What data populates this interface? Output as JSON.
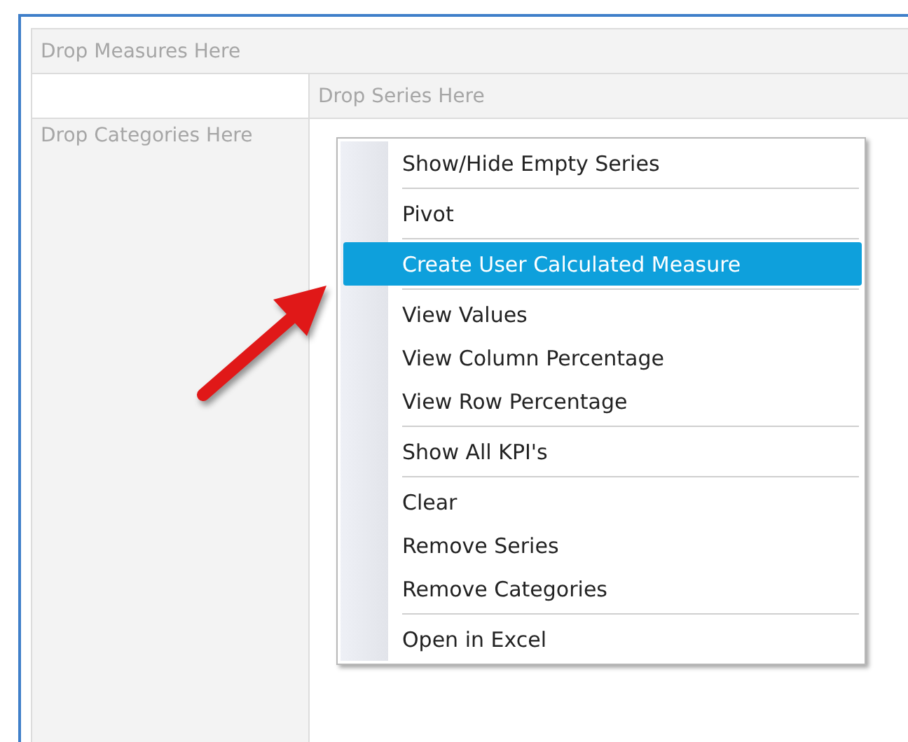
{
  "pivot_grid": {
    "measures_zone": "Drop Measures Here",
    "series_zone": "Drop Series Here",
    "categories_zone": "Drop Categories Here"
  },
  "context_menu": {
    "groups": [
      [
        {
          "label": "Show/Hide Empty Series",
          "selected": false
        }
      ],
      [
        {
          "label": "Pivot",
          "selected": false
        }
      ],
      [
        {
          "label": "Create User Calculated Measure",
          "selected": true
        }
      ],
      [
        {
          "label": "View Values",
          "selected": false
        },
        {
          "label": "View Column Percentage",
          "selected": false
        },
        {
          "label": "View Row Percentage",
          "selected": false
        }
      ],
      [
        {
          "label": "Show All KPI's",
          "selected": false
        }
      ],
      [
        {
          "label": "Clear",
          "selected": false
        },
        {
          "label": "Remove Series",
          "selected": false
        },
        {
          "label": "Remove Categories",
          "selected": false
        }
      ],
      [
        {
          "label": "Open in Excel",
          "selected": false
        }
      ]
    ]
  }
}
